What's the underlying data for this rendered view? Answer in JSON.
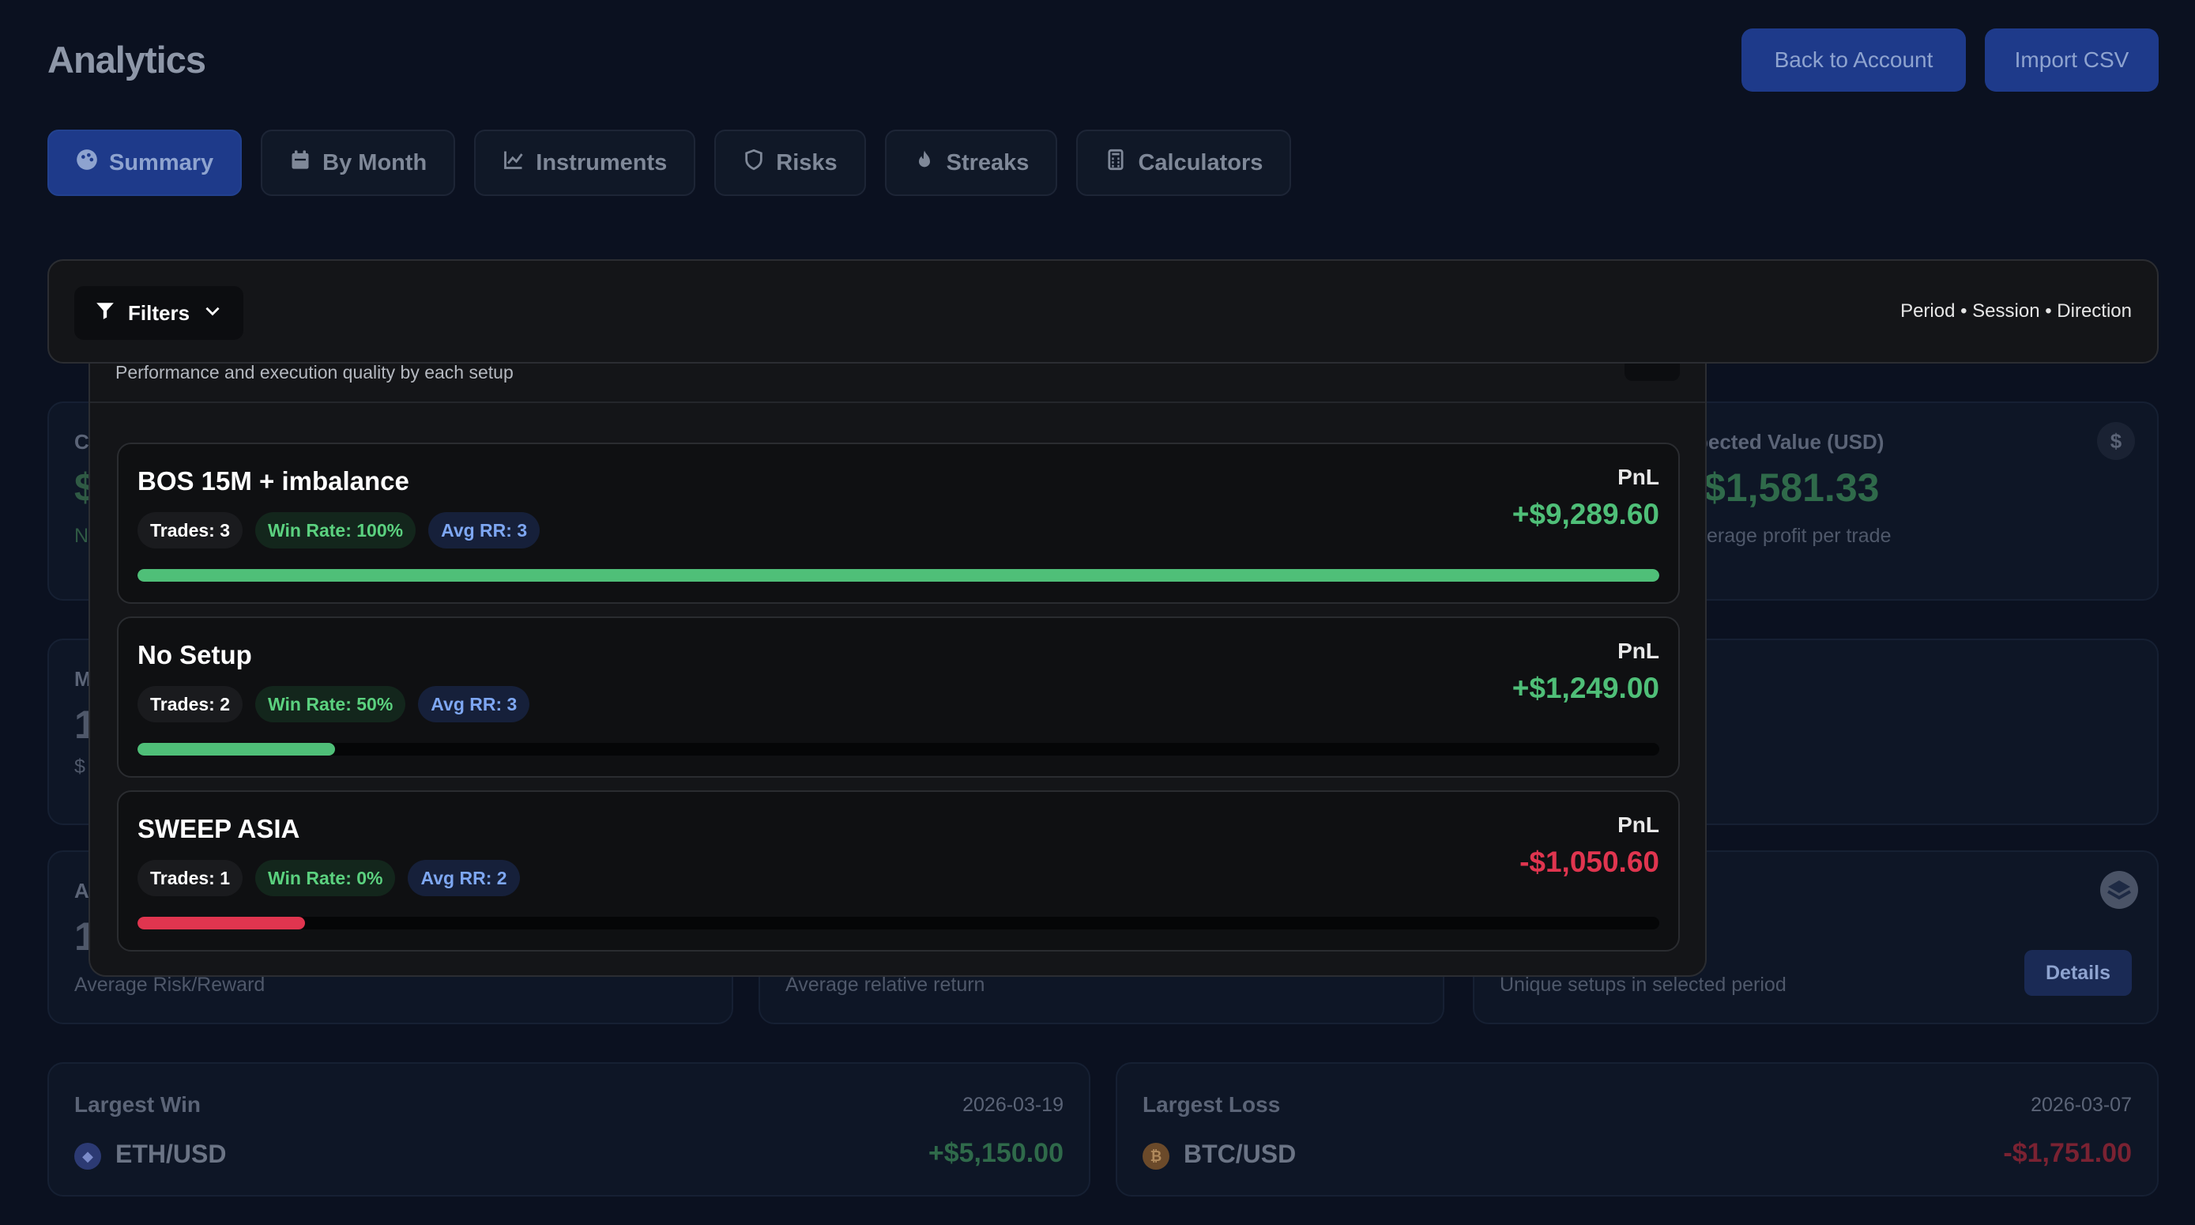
{
  "header": {
    "title": "Analytics",
    "buttons": [
      "Back to Account",
      "Import CSV"
    ]
  },
  "tabs": [
    {
      "label": "Summary",
      "icon": "palette-icon",
      "active": true
    },
    {
      "label": "By Month",
      "icon": "calendar-icon",
      "active": false
    },
    {
      "label": "Instruments",
      "icon": "chart-line-icon",
      "active": false
    },
    {
      "label": "Risks",
      "icon": "shield-icon",
      "active": false
    },
    {
      "label": "Streaks",
      "icon": "flame-icon",
      "active": false
    },
    {
      "label": "Calculators",
      "icon": "calculator-icon",
      "active": false
    }
  ],
  "filters": {
    "label": "Filters",
    "tags": "Period • Session • Direction"
  },
  "background": {
    "expected": {
      "title_partial": "pected Value (USD)",
      "value_partial": "$1,581.33",
      "sub_partial": "erage profit per trade"
    },
    "card_partial": {
      "c_title": "C",
      "c_value": "$",
      "c_sub": "N",
      "m_title": "M",
      "m_value": "1",
      "m_sub": "$",
      "a_title": "A",
      "a_value": "1"
    },
    "bottom_subs": [
      "Average Risk/Reward",
      "Average relative return",
      "Unique setups in selected period"
    ],
    "details_button": "Details",
    "largest_win": {
      "title": "Largest Win",
      "date": "2026-03-19",
      "symbol": "ETH/USD",
      "value": "+$5,150.00"
    },
    "largest_loss": {
      "title": "Largest Loss",
      "date": "2026-03-07",
      "symbol": "BTC/USD",
      "value": "-$1,751.00"
    }
  },
  "modal": {
    "description": "Performance and execution quality by each setup",
    "setups": [
      {
        "name": "BOS 15M + imbalance",
        "trades": "Trades: 3",
        "win_rate": "Win Rate: 100%",
        "avg_rr": "Avg RR: 3",
        "pnl_label": "PnL",
        "pnl": "+$9,289.60",
        "bar_fraction": 1.0,
        "positive": true
      },
      {
        "name": "No Setup",
        "trades": "Trades: 2",
        "win_rate": "Win Rate: 50%",
        "avg_rr": "Avg RR: 3",
        "pnl_label": "PnL",
        "pnl": "+$1,249.00",
        "bar_fraction": 0.13,
        "positive": true
      },
      {
        "name": "SWEEP ASIA",
        "trades": "Trades: 1",
        "win_rate": "Win Rate: 0%",
        "avg_rr": "Avg RR: 2",
        "pnl_label": "PnL",
        "pnl": "-$1,050.60",
        "bar_fraction": 0.11,
        "positive": false
      }
    ]
  },
  "colors": {
    "positive": "#4fbf78",
    "negative": "#e0354f",
    "accent": "#1e3a8a"
  }
}
